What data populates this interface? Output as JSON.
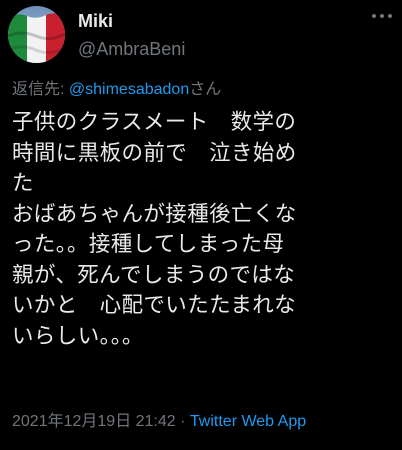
{
  "user": {
    "display_name": "Miki",
    "handle": "@AmbraBeni",
    "avatar_icon": "italian-flag-icon"
  },
  "reply": {
    "prefix": "返信先: ",
    "mention": "@shimesabadon",
    "suffix": "さん"
  },
  "tweet": {
    "text": "子供のクラスメート　数学の\n時間に黒板の前で　泣き始め\nた\nおばあちゃんが接種後亡くな\nった。。接種してしまった母\n親が、死んでしまうのではな\nいかと　心配でいたたまれな\nいらしい。。。"
  },
  "meta": {
    "timestamp": "2021年12月19日 21:42",
    "separator": " · ",
    "source": "Twitter Web App"
  },
  "colors": {
    "background": "#000000",
    "text": "#e7e9ea",
    "secondary": "#71767b",
    "link": "#1d9bf0",
    "flag_green": "#1e8a3c",
    "flag_white": "#f2f2f2",
    "flag_red": "#c8202e"
  }
}
